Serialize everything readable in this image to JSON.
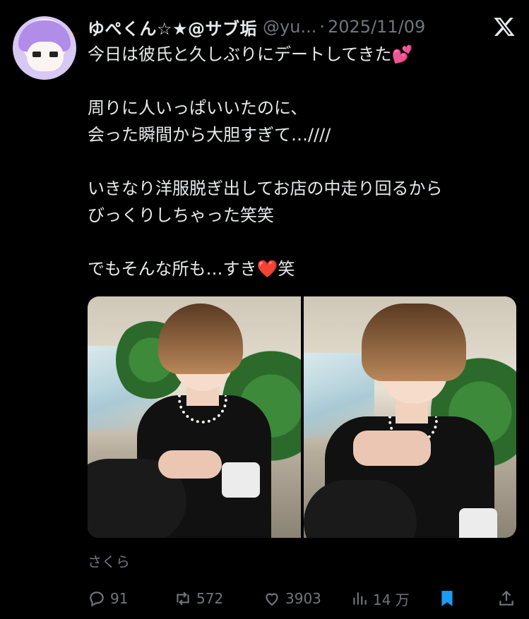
{
  "author": {
    "display_name": "ゆぺくん☆★@サブ垢",
    "handle": "@yu...",
    "separator": "·",
    "date": "2025/11/09"
  },
  "tweet": {
    "line1": "今日は彼氏と久しぶりにデートしてきた💕",
    "line2": "周りに人いっぱいいたのに、",
    "line3": "会った瞬間から大胆すぎて…////",
    "line4": "いきなり洋服脱ぎ出してお店の中走り回るから",
    "line5": "びっくりしちゃった笑笑",
    "line6_a": "でもそんな所も…すき",
    "line6_heart": "❤️",
    "line6_b": "笑"
  },
  "source_label": "さくら",
  "actions": {
    "replies": "91",
    "reposts": "572",
    "likes": "3903",
    "views": "14 万"
  },
  "colors": {
    "background": "#000000",
    "text": "#e7e9ea",
    "muted": "#71767b",
    "bookmark_active": "#1d9bf0"
  },
  "icons": {
    "brand": "x-logo-icon",
    "reply": "reply-icon",
    "repost": "repost-icon",
    "like": "heart-icon",
    "views": "views-icon",
    "bookmark": "bookmark-icon",
    "share": "share-icon"
  }
}
